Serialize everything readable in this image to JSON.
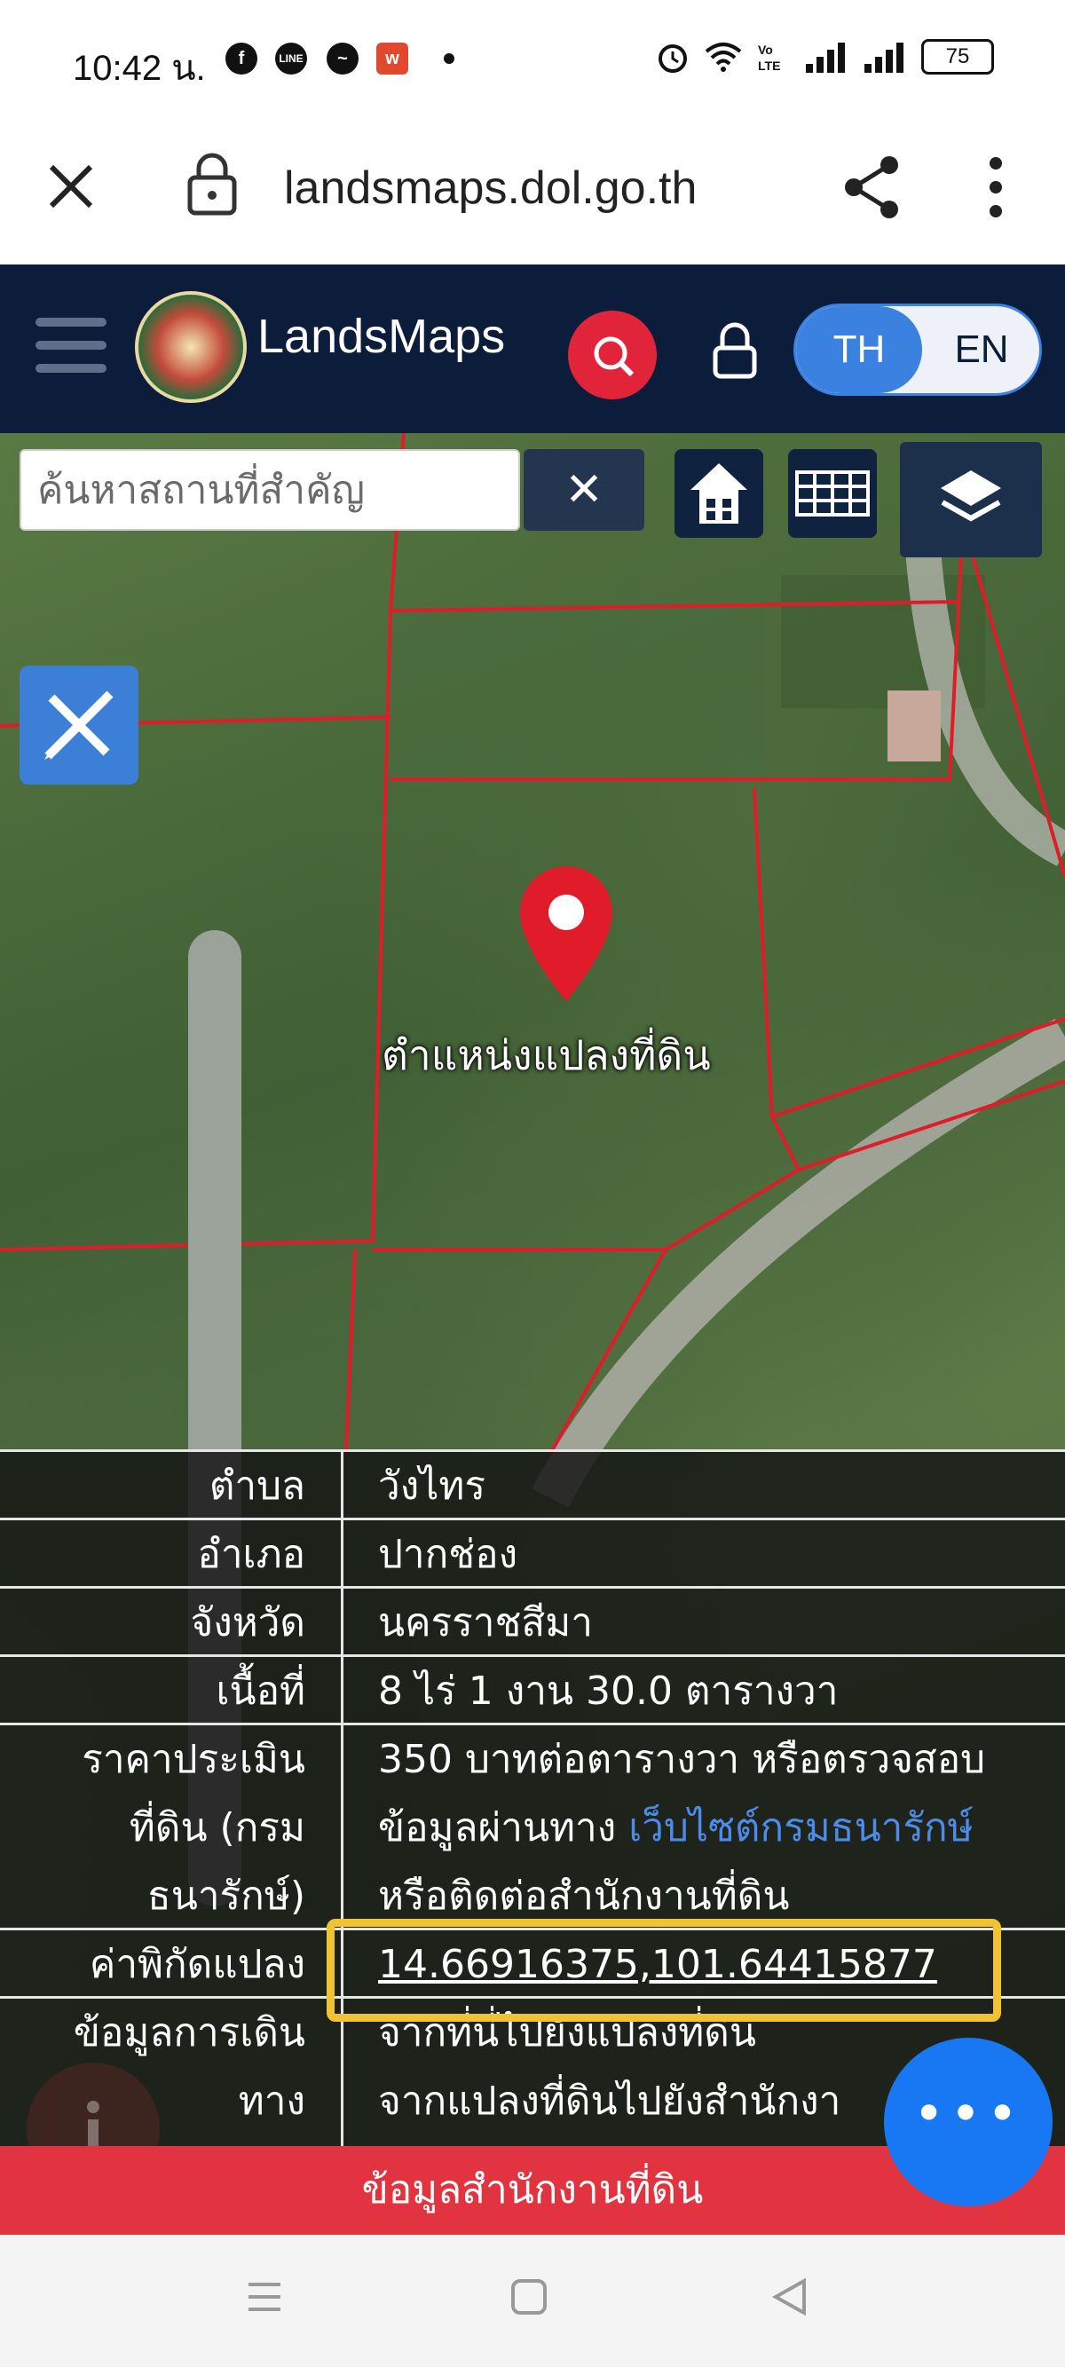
{
  "status_bar": {
    "time": "10:42 น.",
    "notif_icons": [
      "facebook-icon",
      "line-icon",
      "messenger-icon",
      "wish-icon"
    ],
    "battery": "75"
  },
  "browser": {
    "url": "landsmaps.dol.go.th"
  },
  "header": {
    "brand": "LandsMaps",
    "lang_th": "TH",
    "lang_en": "EN"
  },
  "map": {
    "search_placeholder": "ค้นหาสถานที่สำคัญ",
    "clear_symbol": "✕",
    "pin_label": "ตำแหน่งแปลงที่ดิน"
  },
  "info_rows": [
    {
      "label": "ตำบล",
      "value": "วังไทร"
    },
    {
      "label": "อำเภอ",
      "value": "ปากช่อง"
    },
    {
      "label": "จังหวัด",
      "value": "นครราชสีมา"
    },
    {
      "label": "เนื้อที่",
      "value": "8 ไร่ 1 งาน 30.0 ตารางวา"
    }
  ],
  "price": {
    "label_lines": [
      "ราคาประเมิน",
      "ที่ดิน (กรม",
      "ธนารักษ์)"
    ],
    "line1": "350 บาทต่อตารางวา หรือตรวจสอบ",
    "line2_prefix": "ข้อมูลผ่านทาง ",
    "line2_link": "เว็บไซต์กรมธนารักษ์",
    "line3": "หรือติดต่อสำนักงานที่ดิน"
  },
  "coords": {
    "label": "ค่าพิกัดแปลง",
    "value": "14.66916375,101.64415877"
  },
  "directions": {
    "label_lines": [
      "ข้อมูลการเดิน",
      "ทาง"
    ],
    "link1": "จากที่นี่ไปยังแปลงที่ดิน",
    "link2": "จากแปลงที่ดินไปยังสำนักงา"
  },
  "office_bar": "ข้อมูลสำนักงานที่ดิน",
  "colors": {
    "header_bg": "#0b1d3a",
    "accent_red": "#e2243a",
    "accent_blue": "#3b82e0",
    "link_blue": "#4c8ce8",
    "highlight_yellow": "#f1c232",
    "fab_blue": "#1877f2"
  }
}
